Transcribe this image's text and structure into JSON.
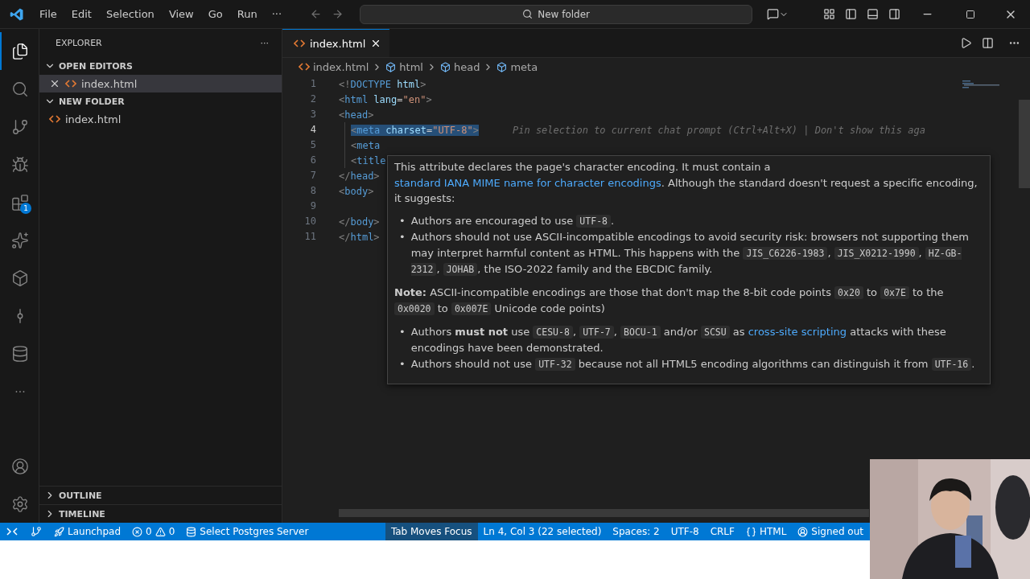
{
  "title_bar": {
    "menu": [
      "File",
      "Edit",
      "Selection",
      "View",
      "Go",
      "Run",
      "···"
    ],
    "search": {
      "value": "New folder"
    }
  },
  "activity_bar": [
    {
      "kind": "files",
      "selected": true
    },
    {
      "kind": "search",
      "selected": false
    },
    {
      "kind": "source-control",
      "selected": false
    },
    {
      "kind": "debug",
      "selected": false
    },
    {
      "kind": "extensions",
      "selected": false,
      "badge": "1"
    },
    {
      "kind": "sparkle",
      "selected": false
    },
    {
      "kind": "python",
      "selected": false
    },
    {
      "kind": "git",
      "selected": false
    },
    {
      "kind": "database",
      "selected": false
    },
    {
      "kind": "more",
      "selected": false,
      "label": "···"
    }
  ],
  "sidebar": {
    "title": "EXPLORER",
    "more": "···",
    "sections": [
      {
        "title": "OPEN EDITORS",
        "expanded": true,
        "items": [
          {
            "name": "index.html",
            "closable": true,
            "selected": true
          }
        ]
      },
      {
        "title": "NEW FOLDER",
        "expanded": true,
        "items": [
          {
            "name": "index.html",
            "closable": false,
            "selected": false
          }
        ]
      }
    ],
    "bottom_sections": [
      {
        "title": "OUTLINE",
        "expanded": false
      },
      {
        "title": "TIMELINE",
        "expanded": false
      }
    ]
  },
  "tabs": [
    {
      "label": "index.html",
      "selected": true
    }
  ],
  "breadcrumbs": [
    "index.html",
    "html",
    "head",
    "meta"
  ],
  "code": [
    {
      "number": "1",
      "selected": false,
      "tokens": [
        {
          "kind": "punct",
          "t": "<!"
        },
        {
          "kind": "kw",
          "t": "DOCTYPE"
        },
        {
          "kind": "attr",
          "t": " html"
        },
        {
          "kind": "punct",
          "t": ">"
        }
      ]
    },
    {
      "number": "2",
      "selected": false,
      "tokens": [
        {
          "kind": "punct",
          "t": "<"
        },
        {
          "kind": "tag",
          "t": "html"
        },
        {
          "kind": "attr",
          "t": " lang"
        },
        {
          "kind": "text",
          "t": "="
        },
        {
          "kind": "str",
          "t": "\"en\""
        },
        {
          "kind": "punct",
          "t": ">"
        }
      ]
    },
    {
      "number": "3",
      "selected": false,
      "tokens": [
        {
          "kind": "punct",
          "t": "<"
        },
        {
          "kind": "tag",
          "t": "head"
        },
        {
          "kind": "punct",
          "t": ">"
        }
      ],
      "children": [
        {
          "number": "4",
          "selected": true,
          "tokens": [
            {
              "kind": "punct",
              "t": "<"
            },
            {
              "kind": "tag",
              "t": "meta"
            },
            {
              "kind": "attr",
              "t": " charset"
            },
            {
              "kind": "text",
              "t": "="
            },
            {
              "kind": "str",
              "t": "\"UTF-8\""
            },
            {
              "kind": "punct",
              "t": ">"
            }
          ],
          "hint": "Pin selection to current chat prompt (Ctrl+Alt+X) | Don't show this aga"
        },
        {
          "number": "5",
          "selected": false,
          "tokens": [
            {
              "kind": "punct",
              "t": "<"
            },
            {
              "kind": "tag",
              "t": "meta"
            }
          ]
        },
        {
          "number": "6",
          "selected": false,
          "tokens": [
            {
              "kind": "punct",
              "t": "<"
            },
            {
              "kind": "tag",
              "t": "title"
            }
          ]
        }
      ]
    },
    {
      "number": "7",
      "selected": false,
      "tokens": [
        {
          "kind": "punct",
          "t": "</"
        },
        {
          "kind": "tag",
          "t": "head"
        },
        {
          "kind": "punct",
          "t": ">"
        }
      ]
    },
    {
      "number": "8",
      "selected": false,
      "tokens": [
        {
          "kind": "punct",
          "t": "<"
        },
        {
          "kind": "tag",
          "t": "body"
        },
        {
          "kind": "punct",
          "t": ">"
        }
      ]
    },
    {
      "number": "9",
      "selected": false
    },
    {
      "number": "10",
      "selected": false,
      "tokens": [
        {
          "kind": "punct",
          "t": "</"
        },
        {
          "kind": "tag",
          "t": "body"
        },
        {
          "kind": "punct",
          "t": ">"
        }
      ]
    },
    {
      "number": "11",
      "selected": false,
      "tokens": [
        {
          "kind": "punct",
          "t": "</"
        },
        {
          "kind": "tag",
          "t": "html"
        },
        {
          "kind": "punct",
          "t": ">"
        }
      ]
    }
  ],
  "hover": [
    {
      "kind": "para",
      "parts": [
        {
          "kind": "text",
          "t": "This attribute declares the page's character encoding. It must contain a "
        },
        {
          "kind": "link",
          "t": "standard IANA MIME name for character encodings"
        },
        {
          "kind": "text",
          "t": ". Although the standard doesn't request a specific encoding, it suggests:"
        }
      ]
    },
    {
      "kind": "bullets",
      "items": [
        {
          "marker": "•",
          "parts": [
            {
              "kind": "text",
              "t": "Authors are encouraged to use "
            },
            {
              "kind": "code",
              "t": "UTF-8"
            },
            {
              "kind": "text",
              "t": "."
            }
          ]
        },
        {
          "marker": "•",
          "parts": [
            {
              "kind": "text",
              "t": "Authors should not use ASCII-incompatible encodings to avoid security risk: browsers not supporting them may interpret harmful content as HTML. This happens with the "
            },
            {
              "kind": "code",
              "t": "JIS_C6226-1983"
            },
            {
              "kind": "text",
              "t": ", "
            },
            {
              "kind": "code",
              "t": "JIS_X0212-1990"
            },
            {
              "kind": "text",
              "t": ", "
            },
            {
              "kind": "code",
              "t": "HZ-GB-2312"
            },
            {
              "kind": "text",
              "t": ", "
            },
            {
              "kind": "code",
              "t": "JOHAB"
            },
            {
              "kind": "text",
              "t": ", the ISO-2022 family and the EBCDIC family."
            }
          ]
        }
      ]
    },
    {
      "kind": "para",
      "parts": [
        {
          "kind": "text",
          "t": "**Note:** ASCII-incompatible encodings are those that don't map the 8-bit code points "
        },
        {
          "kind": "code",
          "t": "0x20"
        },
        {
          "kind": "text",
          "t": " to "
        },
        {
          "kind": "code",
          "t": "0x7E"
        },
        {
          "kind": "text",
          "t": " to the "
        },
        {
          "kind": "code",
          "t": "0x0020"
        },
        {
          "kind": "text",
          "t": " to "
        },
        {
          "kind": "code",
          "t": "0x007E"
        },
        {
          "kind": "text",
          "t": " Unicode code points)"
        }
      ]
    },
    {
      "kind": "bullets",
      "items": [
        {
          "marker": "•",
          "parts": [
            {
              "kind": "text",
              "t": "Authors **must not** use "
            },
            {
              "kind": "code",
              "t": "CESU-8"
            },
            {
              "kind": "text",
              "t": ", "
            },
            {
              "kind": "code",
              "t": "UTF-7"
            },
            {
              "kind": "text",
              "t": ", "
            },
            {
              "kind": "code",
              "t": "BOCU-1"
            },
            {
              "kind": "text",
              "t": " and/or "
            },
            {
              "kind": "code",
              "t": "SCSU"
            },
            {
              "kind": "text",
              "t": " as "
            },
            {
              "kind": "link",
              "t": "cross-site scripting"
            },
            {
              "kind": "text",
              "t": " attacks with these encodings have been demonstrated."
            }
          ]
        },
        {
          "marker": "•",
          "parts": [
            {
              "kind": "text",
              "t": "Authors should not use "
            },
            {
              "kind": "code",
              "t": "UTF-32"
            },
            {
              "kind": "text",
              "t": " because not all HTML5 encoding algorithms can distinguish it from "
            },
            {
              "kind": "code",
              "t": "UTF-16"
            },
            {
              "kind": "text",
              "t": "."
            }
          ]
        }
      ]
    }
  ],
  "status_left": [
    {
      "kind": "remote"
    },
    {
      "kind": "branch"
    },
    {
      "kind": "launchpad",
      "label": "Launchpad"
    },
    {
      "kind": "problems",
      "errors": "0",
      "warnings": "0"
    },
    {
      "kind": "database",
      "label": "Select Postgres Server"
    }
  ],
  "status_right": [
    {
      "kind": "plain",
      "label": "Tab Moves Focus",
      "highlighted": true
    },
    {
      "kind": "plain",
      "label": "Ln 4, Col 3 (22 selected)",
      "highlighted": false
    },
    {
      "kind": "plain",
      "label": "Spaces: 2",
      "highlighted": false
    },
    {
      "kind": "plain",
      "label": "UTF-8",
      "highlighted": false
    },
    {
      "kind": "plain",
      "label": "CRLF",
      "highlighted": false
    },
    {
      "kind": "language",
      "label": "HTML",
      "highlighted": false
    },
    {
      "kind": "account",
      "label": "Signed out",
      "highlighted": false
    }
  ],
  "webcam": {
    "kind": "picture"
  }
}
